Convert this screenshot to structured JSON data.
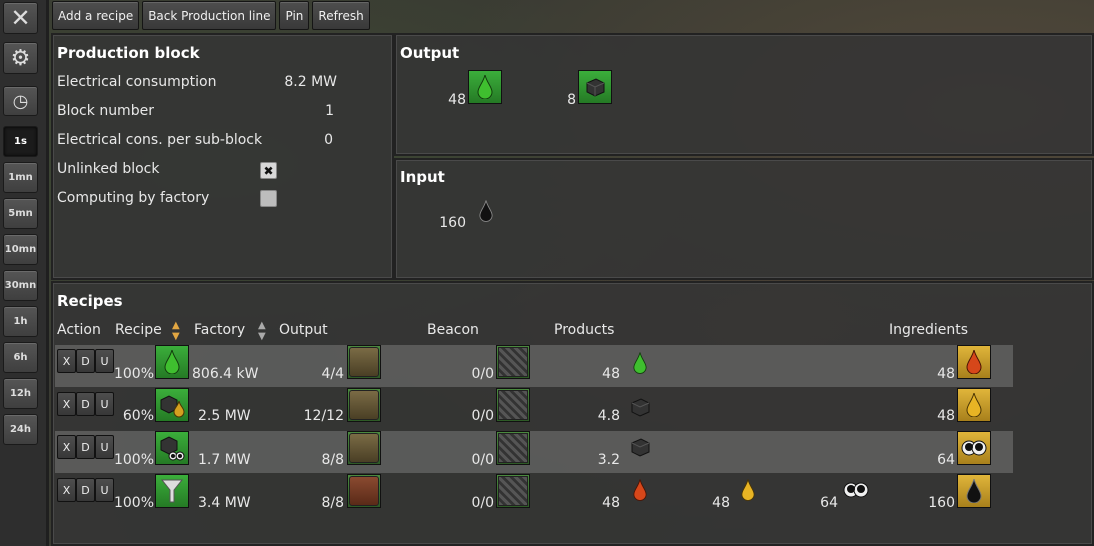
{
  "sidebar": {
    "time_buttons": [
      "1s",
      "1mn",
      "5mn",
      "10mn",
      "30mn",
      "1h",
      "6h",
      "12h",
      "24h"
    ]
  },
  "toolbar": {
    "add_recipe": "Add a recipe",
    "back": "Back Production line",
    "pin": "Pin",
    "refresh": "Refresh"
  },
  "block": {
    "title": "Production block",
    "elec_label": "Electrical consumption",
    "elec_value": "8.2 MW",
    "blocknum_label": "Block number",
    "blocknum_value": "1",
    "sub_label": "Electrical cons. per sub-block",
    "sub_value": "0",
    "unlinked_label": "Unlinked block",
    "unlinked_checked": "✖",
    "computing_label": "Computing by factory"
  },
  "output": {
    "title": "Output",
    "items": [
      {
        "count": "48",
        "icon": "light-oil-icon"
      },
      {
        "count": "8",
        "icon": "solid-fuel-icon"
      }
    ]
  },
  "input": {
    "title": "Input",
    "items": [
      {
        "count": "160",
        "icon": "crude-oil-icon"
      }
    ]
  },
  "recipes": {
    "title": "Recipes",
    "headers": {
      "action": "Action",
      "recipe": "Recipe",
      "factory": "Factory",
      "output": "Output",
      "beacon": "Beacon",
      "products": "Products",
      "ingredients": "Ingredients"
    },
    "rows": [
      {
        "pct": "100%",
        "power": "806.4 kW",
        "machines": "4/4",
        "beacons": "0/0",
        "products": [
          {
            "v": "48",
            "icon": "light-oil-icon"
          }
        ],
        "ingredients": [
          {
            "v": "48",
            "icon": "heavy-oil-icon"
          }
        ]
      },
      {
        "pct": "60%",
        "power": "2.5 MW",
        "machines": "12/12",
        "beacons": "0/0",
        "products": [
          {
            "v": "4.8",
            "icon": "solid-fuel-icon"
          }
        ],
        "ingredients": [
          {
            "v": "48",
            "icon": "petroleum-gas-icon"
          }
        ]
      },
      {
        "pct": "100%",
        "power": "1.7 MW",
        "machines": "8/8",
        "beacons": "0/0",
        "products": [
          {
            "v": "3.2",
            "icon": "solid-fuel-icon"
          }
        ],
        "ingredients": [
          {
            "v": "64",
            "icon": "coal-icon"
          }
        ]
      },
      {
        "pct": "100%",
        "power": "3.4 MW",
        "machines": "8/8",
        "beacons": "0/0",
        "products": [
          {
            "v": "48",
            "icon": "heavy-oil-icon"
          },
          {
            "v": "48",
            "icon": "petroleum-gas-icon"
          },
          {
            "v": "64",
            "icon": "coal-icon"
          }
        ],
        "ingredients": [
          {
            "v": "160",
            "icon": "crude-oil-icon"
          }
        ]
      }
    ],
    "action_buttons": [
      "X",
      "D",
      "U"
    ]
  },
  "colors": {
    "light_oil": "#3aa52f",
    "heavy_oil": "#c9461d",
    "petroleum": "#d4a020",
    "crude": "#111111"
  }
}
